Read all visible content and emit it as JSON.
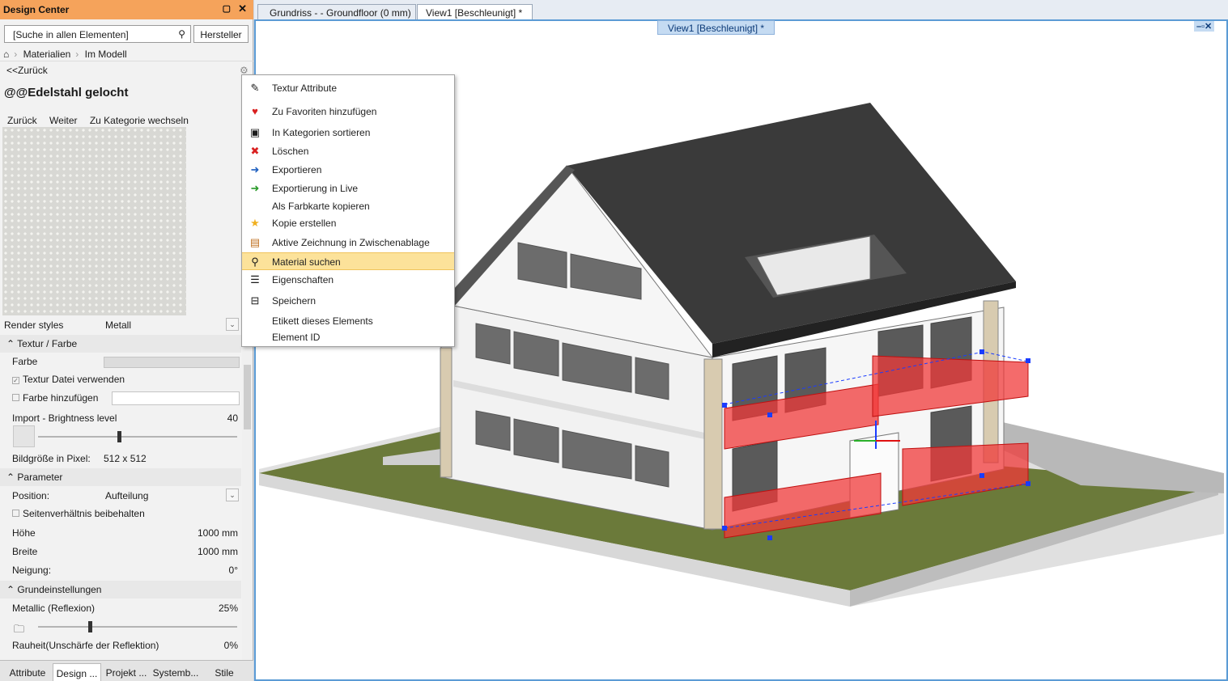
{
  "panel": {
    "title": "Design Center",
    "pin_icon": "pin-icon",
    "close_icon": "close-icon"
  },
  "search": {
    "text": "[Suche in allen Elementen]",
    "icon": "search-icon",
    "hersteller": "Hersteller"
  },
  "breadcrumb": {
    "home_icon": "home-icon",
    "items": [
      "Materialien",
      "Im Modell"
    ]
  },
  "back": "<<Zurück",
  "material_title": "@@Edelstahl gelocht",
  "nav": {
    "zurueck": "Zurück",
    "weiter": "Weiter",
    "kategorie": "Zu Kategorie wechseln"
  },
  "props": {
    "render_styles": {
      "label": "Render styles",
      "value": "Metall"
    },
    "textur_section": "Textur / Farbe",
    "farbe": "Farbe",
    "textur_datei": "Textur Datei verwenden",
    "farbe_hinzufuegen": "Farbe hinzufügen",
    "brightness": {
      "label": "Import - Brightness level",
      "value": "40",
      "level": 0.4
    },
    "bildgroesse": {
      "label": "Bildgröße in Pixel:",
      "value": "512 x 512"
    },
    "parameter_section": "Parameter",
    "position": {
      "label": "Position:",
      "value": "Aufteilung"
    },
    "seitenverhaeltnis": "Seitenverhältnis beibehalten",
    "hoehe": {
      "label": "Höhe",
      "value": "1000 mm"
    },
    "breite": {
      "label": "Breite",
      "value": "1000 mm"
    },
    "neigung": {
      "label": "Neigung:",
      "value": "0°"
    },
    "grund_section": "Grundeinstellungen",
    "metallic": {
      "label": "Metallic (Reflexion)",
      "value": "25%",
      "level": 0.25
    },
    "rauheit": {
      "label": "Rauheit(Unschärfe der Reflektion)",
      "value": "0%"
    }
  },
  "bottom_tabs": [
    "Attribute",
    "Design ...",
    "Projekt ...",
    "Systemb...",
    "Stile"
  ],
  "doc_tabs": [
    "Grundriss -  - Groundfloor (0 mm)",
    "View1 [Beschleunigt] *"
  ],
  "view_label": "View1 [Beschleunigt] *",
  "window_controls": "–▫✕",
  "context_menu": [
    {
      "label": "Textur Attribute",
      "icon": "pencil-icon"
    },
    {
      "label": "Zu Favoriten hinzufügen",
      "icon": "heart-icon"
    },
    {
      "label": "In Kategorien sortieren",
      "icon": "sort-icon"
    },
    {
      "label": "Löschen",
      "icon": "delete-icon"
    },
    {
      "label": "Exportieren",
      "icon": "export-icon"
    },
    {
      "label": "Exportierung in Live",
      "icon": "export-live-icon"
    },
    {
      "label": "Als Farbkarte kopieren",
      "icon": ""
    },
    {
      "label": "Kopie erstellen",
      "icon": "star-icon"
    },
    {
      "label": "Aktive Zeichnung in Zwischenablage",
      "icon": "clipboard-icon"
    },
    {
      "label": "Material suchen",
      "icon": "search-icon",
      "highlighted": true
    },
    {
      "label": "Eigenschaften",
      "icon": "properties-icon"
    },
    {
      "label": "Speichern",
      "icon": "save-icon"
    },
    {
      "label": "Etikett dieses Elements",
      "icon": ""
    },
    {
      "label": "Element ID",
      "icon": ""
    }
  ],
  "colors": {
    "title_bar": "#f5a35b",
    "highlight": "#fce29a",
    "roof": "#3a3a3a",
    "ground": "#6b7a3a",
    "railing": "#f03a3a",
    "selection": "#1a3cff"
  }
}
